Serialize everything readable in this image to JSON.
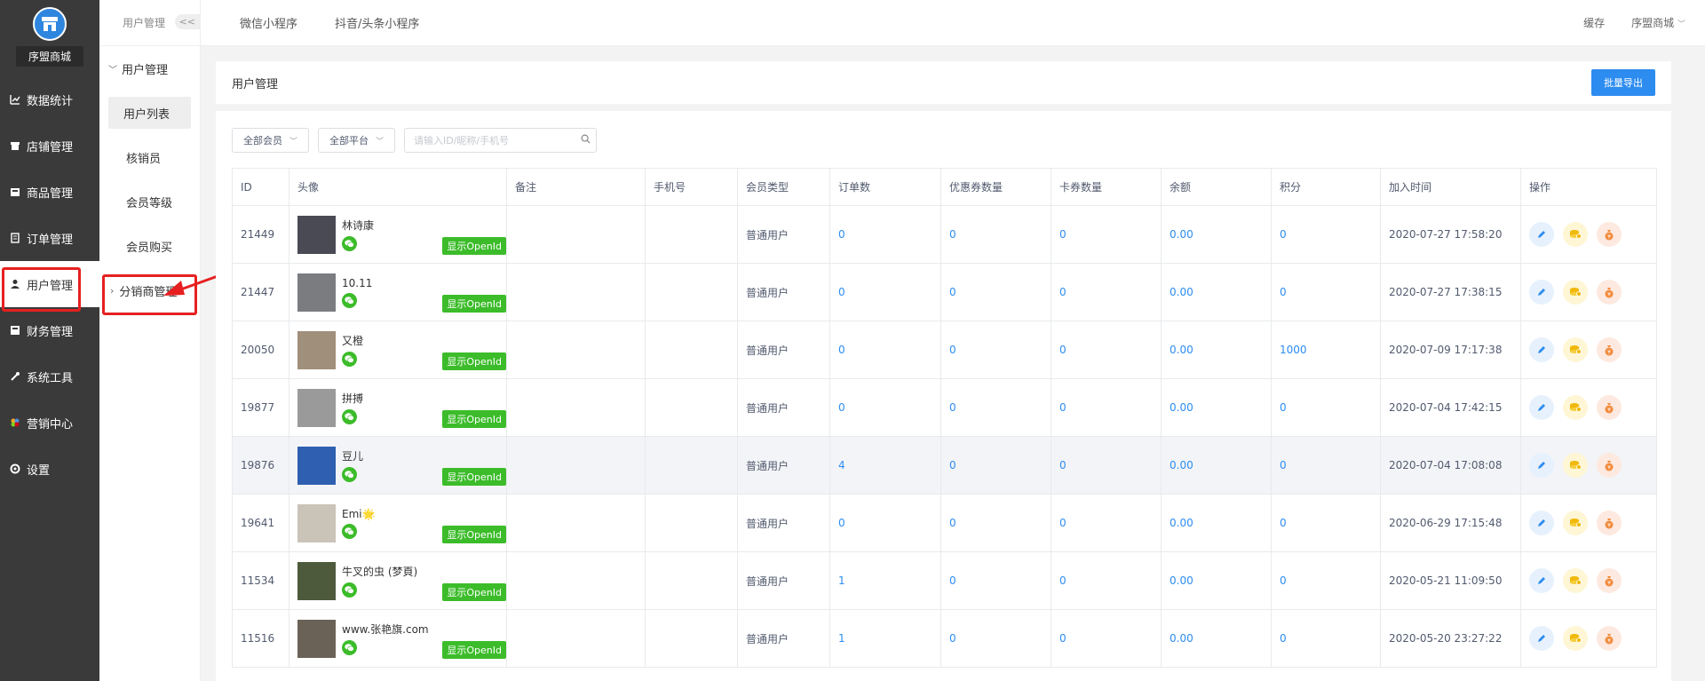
{
  "app": {
    "logo_name": "序盟商城"
  },
  "sidebar": {
    "items": [
      {
        "label": "数据统计",
        "icon": "chart-icon"
      },
      {
        "label": "店铺管理",
        "icon": "store-icon"
      },
      {
        "label": "商品管理",
        "icon": "goods-icon"
      },
      {
        "label": "订单管理",
        "icon": "order-icon"
      },
      {
        "label": "用户管理",
        "icon": "user-icon",
        "active": true
      },
      {
        "label": "财务管理",
        "icon": "finance-icon"
      },
      {
        "label": "系统工具",
        "icon": "wrench-icon"
      },
      {
        "label": "营销中心",
        "icon": "marketing-icon"
      },
      {
        "label": "设置",
        "icon": "settings-icon"
      }
    ]
  },
  "subnav": {
    "header": "用户管理",
    "collapse": "<<",
    "group": "用户管理",
    "items": [
      "用户列表",
      "核销员",
      "会员等级",
      "会员购买"
    ],
    "group2": "分销商管理"
  },
  "topbar": {
    "tabs": [
      "微信小程序",
      "抖音/头条小程序"
    ],
    "cache": "缓存",
    "store": "序盟商城"
  },
  "page": {
    "title": "用户管理",
    "export_label": "批量导出"
  },
  "filters": {
    "member": "全部会员",
    "platform": "全部平台",
    "search_placeholder": "请输入ID/昵称/手机号"
  },
  "table": {
    "columns": [
      "ID",
      "头像",
      "备注",
      "手机号",
      "会员类型",
      "订单数",
      "优惠券数量",
      "卡券数量",
      "余额",
      "积分",
      "加入时间",
      "操作"
    ],
    "openid_label": "显示OpenId",
    "rows": [
      {
        "id": "21449",
        "nick": "林诗康",
        "note": "",
        "phone": "",
        "type": "普通用户",
        "orders": "0",
        "coupons": "0",
        "cards": "0",
        "balance": "0.00",
        "points": "0",
        "joined": "2020-07-27 17:58:20",
        "avatar": "#4a4a55"
      },
      {
        "id": "21447",
        "nick": "10.11",
        "note": "",
        "phone": "",
        "type": "普通用户",
        "orders": "0",
        "coupons": "0",
        "cards": "0",
        "balance": "0.00",
        "points": "0",
        "joined": "2020-07-27 17:38:15",
        "avatar": "#7a7c80"
      },
      {
        "id": "20050",
        "nick": "又橙",
        "note": "",
        "phone": "",
        "type": "普通用户",
        "orders": "0",
        "coupons": "0",
        "cards": "0",
        "balance": "0.00",
        "points": "1000",
        "joined": "2020-07-09 17:17:38",
        "avatar": "#a08f7a"
      },
      {
        "id": "19877",
        "nick": "拼搏",
        "note": "",
        "phone": "",
        "type": "普通用户",
        "orders": "0",
        "coupons": "0",
        "cards": "0",
        "balance": "0.00",
        "points": "0",
        "joined": "2020-07-04 17:42:15",
        "avatar": "#9a9a9a"
      },
      {
        "id": "19876",
        "nick": "豆儿",
        "note": "",
        "phone": "",
        "type": "普通用户",
        "orders": "4",
        "coupons": "0",
        "cards": "0",
        "balance": "0.00",
        "points": "0",
        "joined": "2020-07-04 17:08:08",
        "avatar": "#2f5fb0",
        "hover": true
      },
      {
        "id": "19641",
        "nick": "Emi🌟",
        "note": "",
        "phone": "",
        "type": "普通用户",
        "orders": "0",
        "coupons": "0",
        "cards": "0",
        "balance": "0.00",
        "points": "0",
        "joined": "2020-06-29 17:15:48",
        "avatar": "#c9c3b8"
      },
      {
        "id": "11534",
        "nick": "牛叉的虫 (梦頁)",
        "note": "",
        "phone": "",
        "type": "普通用户",
        "orders": "1",
        "coupons": "0",
        "cards": "0",
        "balance": "0.00",
        "points": "0",
        "joined": "2020-05-21 11:09:50",
        "avatar": "#4d5a3c"
      },
      {
        "id": "11516",
        "nick": "www.张艳旗.com",
        "note": "",
        "phone": "",
        "type": "普通用户",
        "orders": "1",
        "coupons": "0",
        "cards": "0",
        "balance": "0.00",
        "points": "0",
        "joined": "2020-05-20 23:27:22",
        "avatar": "#6b6257"
      }
    ]
  },
  "colors": {
    "primary": "#2d8cf0",
    "wechat": "#3cbc2a",
    "sidebar": "#3a3a3a",
    "highlight": "#e62020"
  }
}
